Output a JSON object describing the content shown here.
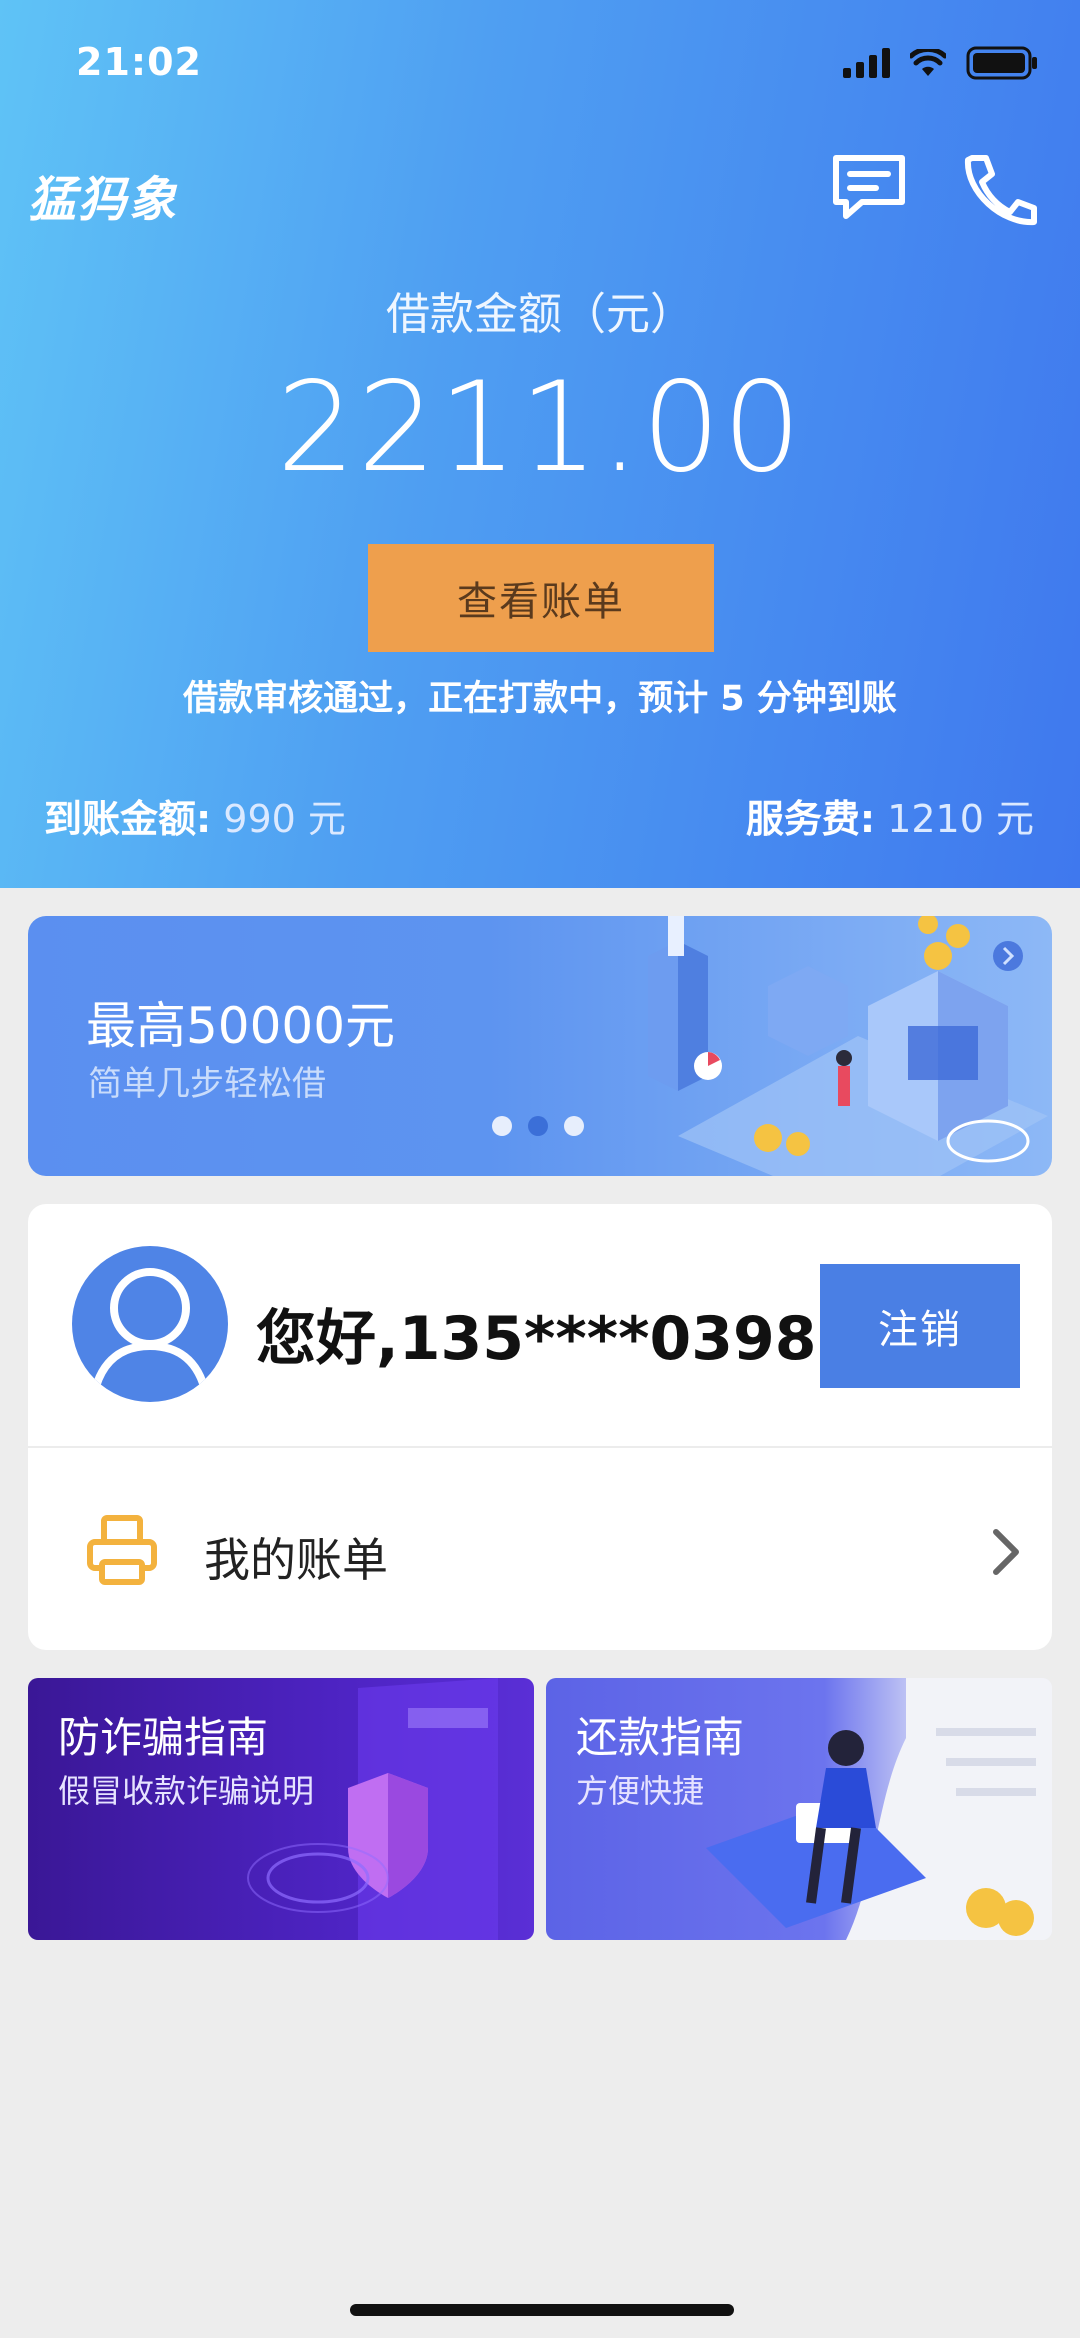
{
  "status_bar": {
    "time": "21:02"
  },
  "header": {
    "logo": "猛犸象"
  },
  "loan": {
    "label": "借款金额（元）",
    "amount": "2211.00",
    "view_bill_label": "查看账单",
    "notice": "借款审核通过，正在打款中，预计 5 分钟到账",
    "arrived_label": "到账金额:",
    "arrived_value": " 990 元",
    "fee_label": "服务费:",
    "fee_value": " 1210 元"
  },
  "banner": {
    "title": "最高50000元",
    "subtitle": "简单几步轻松借",
    "page_count": 3,
    "active_index": 1
  },
  "account": {
    "greeting": "您好,135****0398",
    "logout_label": "注销",
    "bill_row_label": "我的账单"
  },
  "tiles": [
    {
      "title": "防诈骗指南",
      "subtitle": "假冒收款诈骗说明"
    },
    {
      "title": "还款指南",
      "subtitle": "方便快捷"
    }
  ],
  "colors": {
    "accent": "#4a7fe4",
    "bill_button": "#ee9f4d",
    "icon_yellow": "#f3b23e"
  }
}
